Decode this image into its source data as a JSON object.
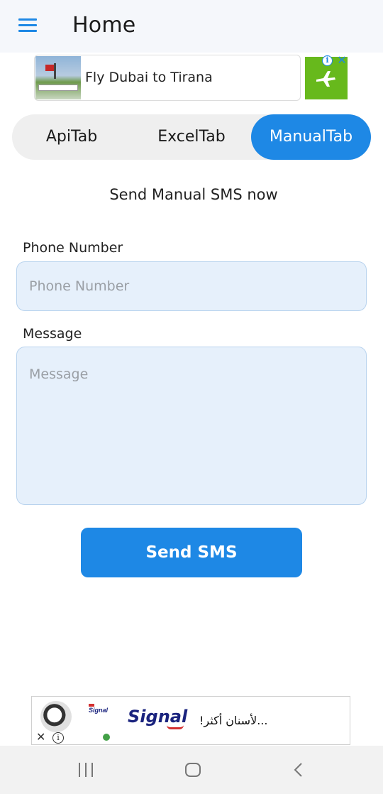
{
  "app_bar": {
    "title": "Home",
    "menu_icon": "hamburger-menu-icon",
    "background": "#f5f7fb",
    "accent": "#1e88e5"
  },
  "top_ad": {
    "headline": "Fly Dubai to Tirana",
    "badge_color": "#67b91c",
    "info_icon": "ad-info-icon",
    "close_icon": "ad-close-icon"
  },
  "tabs": [
    {
      "label": "ApiTab",
      "selected": false
    },
    {
      "label": "ExcelTab",
      "selected": false
    },
    {
      "label": "ManualTab",
      "selected": true
    }
  ],
  "main": {
    "heading": "Send Manual SMS now",
    "phone": {
      "label": "Phone Number",
      "placeholder": "Phone Number",
      "value": ""
    },
    "message": {
      "label": "Message",
      "placeholder": "Message",
      "value": ""
    },
    "send_label": "Send SMS",
    "button_color": "#1e88e5",
    "field_color": "#e6f0fb"
  },
  "bottom_ad": {
    "brand": "Signal",
    "pack_label": "Signal",
    "text": "...لأسنان أكثر!",
    "close_icon": "close-icon",
    "info_icon": "info-icon"
  },
  "system_nav": {
    "recents_icon": "recents-icon",
    "home_icon": "home-icon",
    "back_icon": "back-icon"
  }
}
